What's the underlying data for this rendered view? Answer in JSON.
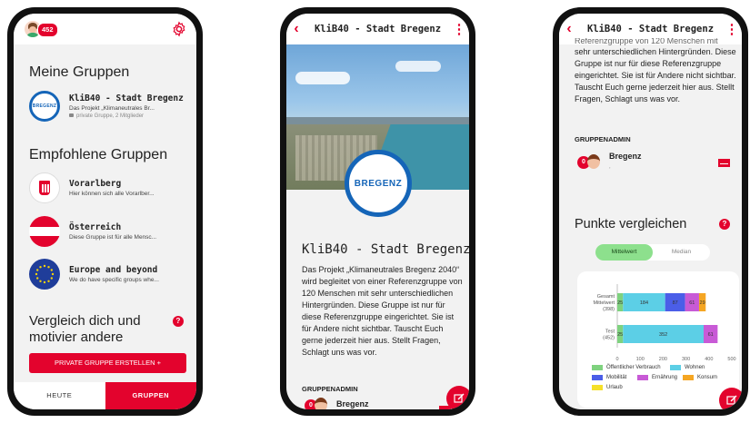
{
  "colors": {
    "brand": "#e3032d",
    "chart_oeffentlich": "#7fd27f",
    "chart_wohnen": "#5ccfe6",
    "chart_mobilitaet": "#4b5ee8",
    "chart_ernaehrung": "#c85ad6",
    "chart_konsum": "#f5a623",
    "chart_urlaub": "#f5e02a"
  },
  "screen1": {
    "badge_count": "452",
    "my_groups_title": "Meine Gruppen",
    "my_groups": [
      {
        "name": "KliB40 - Stadt Bregenz",
        "desc": "Das Projekt „Klimaneutrales Br...",
        "meta": "private Gruppe, 2 Mitglieder",
        "logo": "BREGENZ"
      }
    ],
    "recommended_title": "Empfohlene Gruppen",
    "recommended": [
      {
        "name": "Vorarlberg",
        "desc": "Hier können sich alle Vorarlber...",
        "icon": "vorarlberg-coat-icon"
      },
      {
        "name": "Österreich",
        "desc": "Diese Gruppe ist für alle Mensc...",
        "icon": "austria-flag-icon"
      },
      {
        "name": "Europe and beyond",
        "desc": "We do have specific groups whe...",
        "icon": "eu-flag-icon"
      }
    ],
    "compare_title": "Vergleich dich und motivier andere",
    "create_button": "PRIVATE GRUPPE ERSTELLEN +",
    "tab_today": "HEUTE",
    "tab_groups": "GRUPPEN"
  },
  "screen2": {
    "header_title": "KliB40 - Stadt Bregenz",
    "logo": "BREGENZ",
    "group_title": "KliB40 - Stadt Bregenz",
    "description": "Das Projekt „Klimaneutrales Bregenz 2040“ wird begleitet von einer Referenzgruppe von 120 Menschen mit sehr unterschiedlichen Hintergründen. Diese Gruppe ist nur für diese Referenzgruppe eingerichtet. Sie ist für Andere nicht sichtbar. Tauscht Euch gerne jederzeit hier aus. Stellt Fragen, Schlagt uns was vor.",
    "admin_title": "GRUPPENADMIN",
    "admin_name": "Bregenz",
    "admin_badge": "0"
  },
  "screen3": {
    "header_title": "KliB40 - Stadt Bregenz",
    "desc_cut": "Referenzgruppe von 120 Menschen mit",
    "description": "sehr unterschiedlichen Hintergründen. Diese Gruppe ist nur für diese Referenzgruppe eingerichtet. Sie ist für Andere nicht sichtbar. Tauscht Euch gerne jederzeit hier aus. Stellt Fragen, Schlagt uns was vor.",
    "admin_title": "GRUPPENADMIN",
    "admin_name": "Bregenz",
    "admin_sub": ",",
    "admin_badge": "0",
    "points_title": "Punkte vergleichen",
    "seg_mean": "Mittelwert",
    "seg_median": "Median"
  },
  "chart_data": {
    "type": "bar",
    "orientation": "horizontal",
    "stacked": true,
    "categories": [
      "Gesamt Mittelwert (398)",
      "Test (452)"
    ],
    "series": [
      {
        "name": "Öffentlicher Verbrauch",
        "values": [
          25,
          25
        ]
      },
      {
        "name": "Wohnen",
        "values": [
          184,
          352
        ]
      },
      {
        "name": "Mobilität",
        "values": [
          87,
          0
        ]
      },
      {
        "name": "Ernährung",
        "values": [
          61,
          61
        ]
      },
      {
        "name": "Konsum",
        "values": [
          29,
          0
        ]
      },
      {
        "name": "Urlaub",
        "values": [
          0,
          0
        ]
      }
    ],
    "data_labels": [
      [
        "25",
        "184",
        "87",
        "61",
        "29"
      ],
      [
        "25",
        "352",
        "61"
      ]
    ],
    "xticks": [
      "0",
      "100",
      "200",
      "300",
      "400",
      "500"
    ],
    "xlim": [
      0,
      500
    ]
  }
}
